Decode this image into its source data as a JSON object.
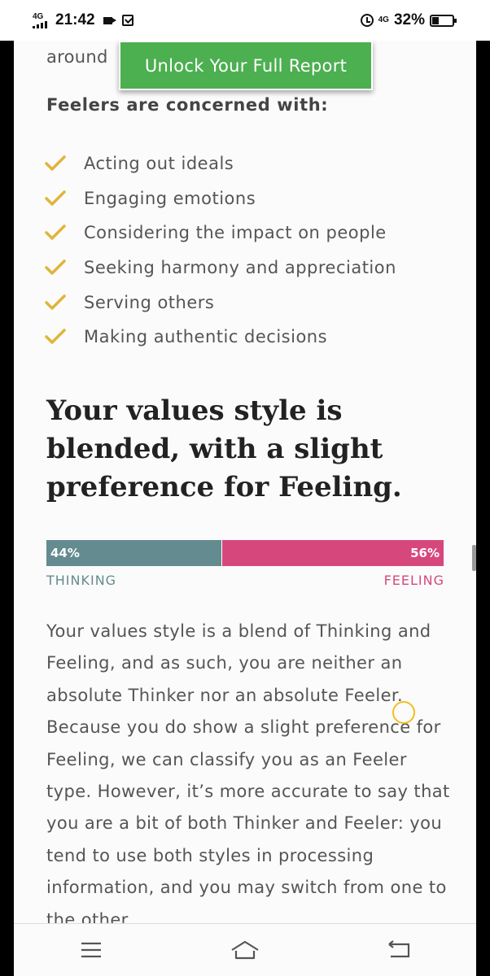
{
  "status_bar": {
    "network_left": "4G",
    "time": "21:42",
    "network_right": "4G",
    "battery_percent": "32%",
    "battery_level": 0.32
  },
  "page": {
    "partial_text": "around",
    "unlock_button_label": "Unlock Your Full Report",
    "feelers_heading": "Feelers are concerned with:",
    "concerns": [
      "Acting out ideals",
      "Engaging emotions",
      "Considering the impact on people",
      "Seeking harmony and appreciation",
      "Serving others",
      "Making authentic decisions"
    ],
    "style_heading": "Your values style is blended, with a slight preference for Feeling.",
    "bar": {
      "thinking_percent": "44%",
      "feeling_percent": "56%",
      "thinking_fraction": 0.44,
      "thinking_label": "THINKING",
      "feeling_label": "FEELING",
      "thinking_color": "#648b8f",
      "feeling_color": "#d6487c"
    },
    "body_paragraph": "Your values style is a blend of Thinking and Feeling, and as such, you are neither an absolute Thinker nor an absolute Feeler. Because you do show a slight preference for Feeling, we can classify you as an Feeler type. However, it’s more accurate to say that you are a bit of both Thinker and Feeler: you tend to use both styles in processing information, and you may switch from one to the other"
  },
  "colors": {
    "accent_green": "#4caf50",
    "check_gold": "#e0b53a"
  },
  "nav_icons": [
    "menu-icon",
    "home-icon",
    "back-icon"
  ]
}
